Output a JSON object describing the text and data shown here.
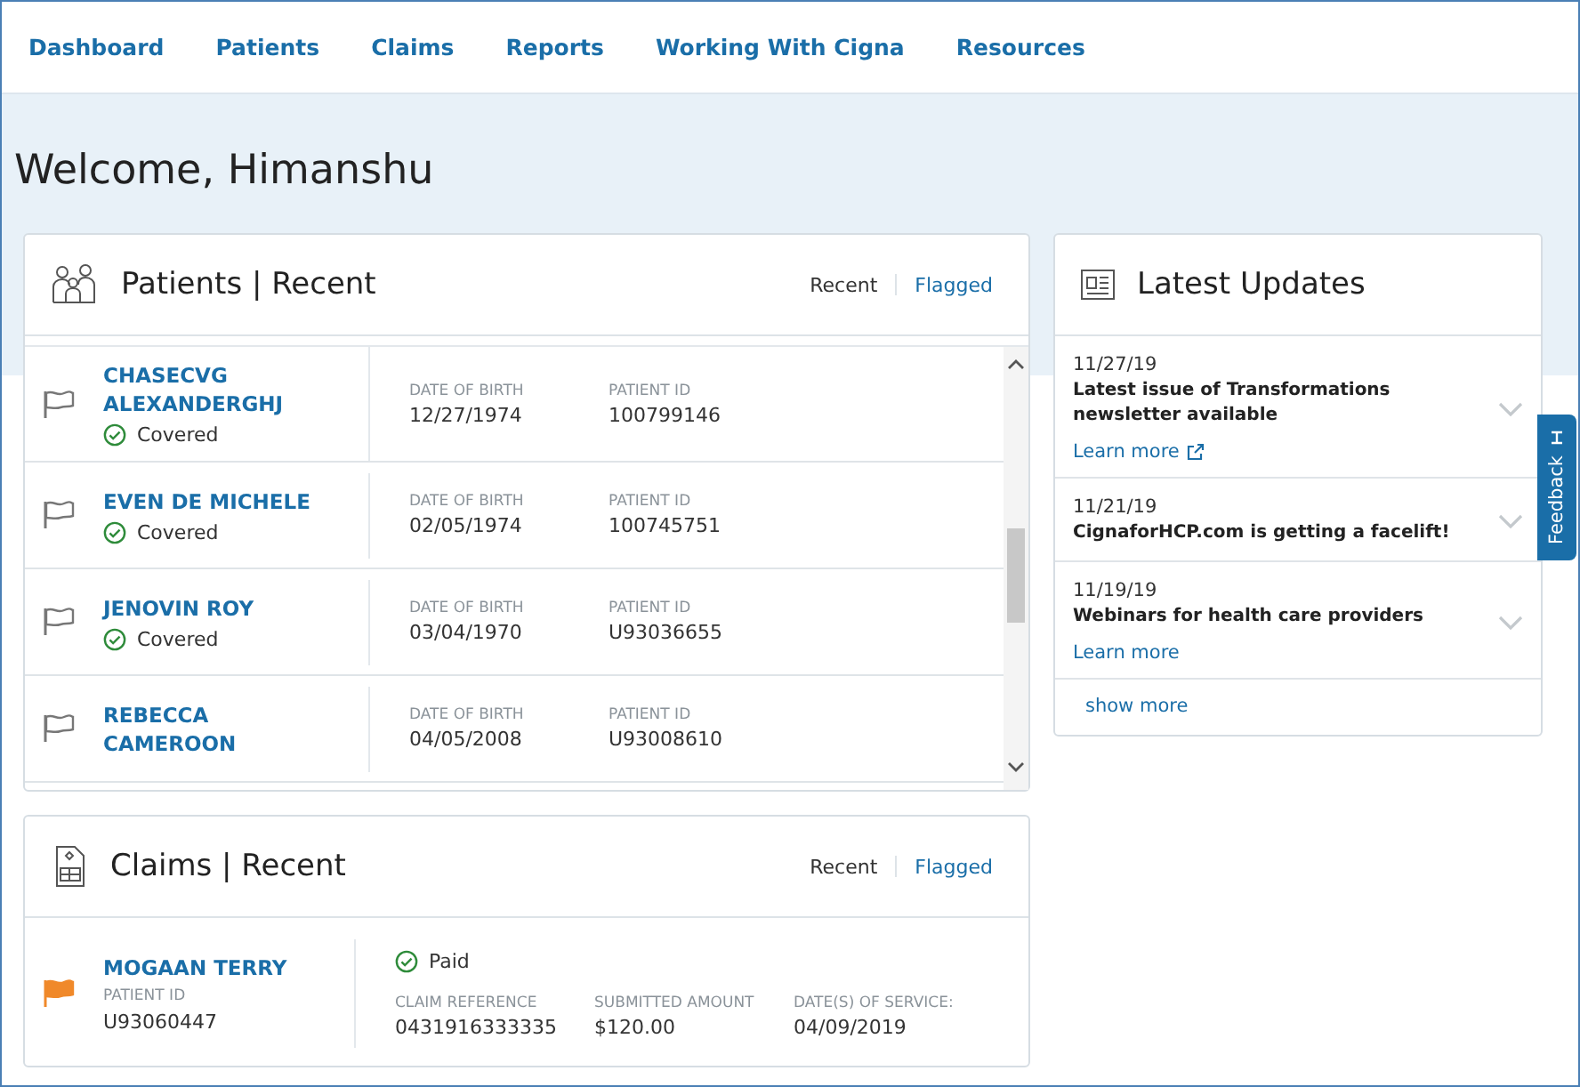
{
  "nav": [
    {
      "label": "Dashboard"
    },
    {
      "label": "Patients"
    },
    {
      "label": "Claims"
    },
    {
      "label": "Reports"
    },
    {
      "label": "Working With Cigna"
    },
    {
      "label": "Resources"
    }
  ],
  "welcome": "Welcome, Himanshu",
  "patients": {
    "title": "Patients | Recent",
    "tabs": [
      {
        "label": "Recent",
        "selected": true
      },
      {
        "label": "Flagged",
        "selected": false
      }
    ],
    "rows": [
      {
        "name": "CHASECVG ALEXANDERGHJ",
        "flagged": false,
        "status": "Covered",
        "dob_label": "DATE OF BIRTH",
        "dob": "12/27/1974",
        "id_label": "PATIENT ID",
        "id": "100799146"
      },
      {
        "name": "EVEN DE MICHELE",
        "flagged": false,
        "status": "Covered",
        "dob_label": "DATE OF BIRTH",
        "dob": "02/05/1974",
        "id_label": "PATIENT ID",
        "id": "100745751"
      },
      {
        "name": "JENOVIN ROY",
        "flagged": false,
        "status": "Covered",
        "dob_label": "DATE OF BIRTH",
        "dob": "03/04/1970",
        "id_label": "PATIENT ID",
        "id": "U93036655"
      },
      {
        "name": "REBECCA CAMEROON",
        "flagged": false,
        "dob_label": "DATE OF BIRTH",
        "dob": "04/05/2008",
        "id_label": "PATIENT ID",
        "id": "U93008610"
      }
    ]
  },
  "claims": {
    "title": "Claims | Recent",
    "tabs": [
      {
        "label": "Recent",
        "selected": true
      },
      {
        "label": "Flagged",
        "selected": false
      }
    ],
    "rows": [
      {
        "name": "MOGAAN TERRY",
        "flagged": true,
        "id_label": "PATIENT ID",
        "id": "U93060447",
        "status": "Paid",
        "fields": [
          {
            "label": "CLAIM REFERENCE",
            "value": "0431916333335"
          },
          {
            "label": "SUBMITTED AMOUNT",
            "value": "$120.00"
          },
          {
            "label": "DATE(S) OF SERVICE:",
            "value": "04/09/2019"
          }
        ]
      }
    ]
  },
  "updates": {
    "title": "Latest Updates",
    "items": [
      {
        "date": "11/27/19",
        "title": "Latest issue of Transformations newsletter available",
        "link": "Learn more",
        "external": true
      },
      {
        "date": "11/21/19",
        "title": "CignaforHCP.com is getting a facelift!"
      },
      {
        "date": "11/19/19",
        "title": "Webinars for health care providers",
        "link": "Learn more",
        "external": false
      }
    ],
    "more": "show more"
  },
  "feedback": "Feedback"
}
